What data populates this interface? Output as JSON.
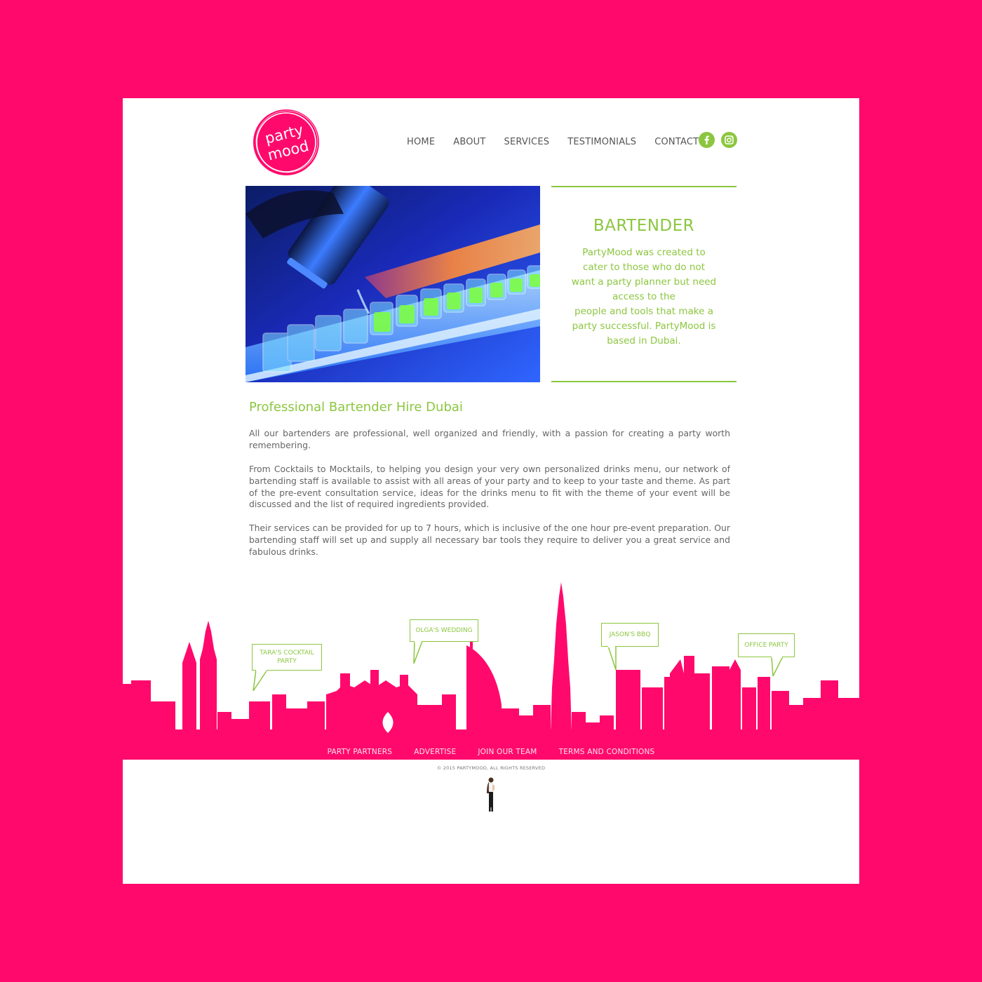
{
  "brand": {
    "logo_line1": "party",
    "logo_line2": "mood",
    "colors": {
      "pink": "#ff0a6c",
      "green": "#8cc63f",
      "text_gray": "#666666"
    }
  },
  "nav": {
    "items": [
      {
        "label": "HOME"
      },
      {
        "label": "ABOUT"
      },
      {
        "label": "SERVICES"
      },
      {
        "label": "TESTIMONIALS"
      },
      {
        "label": "CONTACT"
      }
    ],
    "social": [
      {
        "icon": "facebook-icon"
      },
      {
        "icon": "instagram-icon"
      }
    ]
  },
  "hero": {
    "image_icon": "cocktail-shot-glasses-photo",
    "title": "BARTENDER",
    "text_lines": [
      "PartyMood was created to",
      "cater to those who do not",
      "want a party planner but need",
      "access to the",
      "people and tools that make a",
      "party successful. PartyMood is",
      "based in Dubai."
    ]
  },
  "content": {
    "title": "Professional Bartender Hire Dubai",
    "paragraphs": [
      "All our bartenders are professional, well organized and friendly, with a passion for creating a party worth remembering.",
      "From Cocktails to Mocktails, to helping you design your very own personalized drinks menu, our network of bartending staff is available to assist with all areas of your party and to keep to your taste and theme. As part of the pre-event consultation service, ideas for the drinks menu to fit with the theme of your event will be discussed and the list of required ingredients provided.",
      "Their services can be provided for up to 7 hours, which is inclusive of the one hour pre-event preparation. Our bartending staff will set up and supply all necessary bar tools they require to deliver you a great service and fabulous drinks."
    ]
  },
  "skyline": {
    "bubbles": [
      {
        "label": "TARA'S COCKTAIL PARTY"
      },
      {
        "label": "OLGA'S WEDDING"
      },
      {
        "label": "JASON'S BBQ"
      },
      {
        "label": "OFFICE PARTY"
      }
    ]
  },
  "footer": {
    "links": [
      {
        "label": "PARTY PARTNERS"
      },
      {
        "label": "ADVERTISE"
      },
      {
        "label": "JOIN OUR TEAM"
      },
      {
        "label": "TERMS AND CONDITIONS"
      }
    ],
    "copyright": "© 2015 PARTYMOOD, ALL RIGHTS RESERVED"
  }
}
